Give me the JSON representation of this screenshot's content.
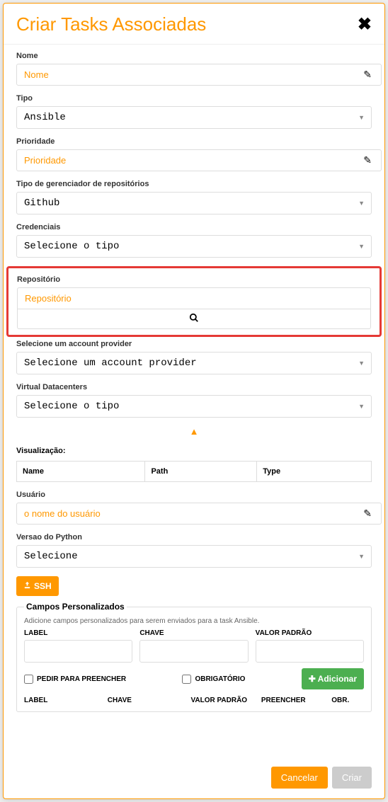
{
  "modal": {
    "title": "Criar Tasks Associadas"
  },
  "fields": {
    "name_label": "Nome",
    "name_placeholder": "Nome",
    "type_label": "Tipo",
    "type_value": "Ansible",
    "priority_label": "Prioridade",
    "priority_placeholder": "Prioridade",
    "repomgr_label": "Tipo de gerenciador de repositórios",
    "repomgr_value": "Github",
    "creds_label": "Credenciais",
    "creds_value": "Selecione o tipo",
    "repo_label": "Repositório",
    "repo_placeholder": "Repositório",
    "accprov_label": "Selecione um account provider",
    "accprov_value": "Selecione um account provider",
    "vdc_label": "Virtual Datacenters",
    "vdc_value": "Selecione o tipo",
    "vis_label": "Visualização:",
    "table": {
      "h1": "Name",
      "h2": "Path",
      "h3": "Type"
    },
    "user_label": "Usuário",
    "user_placeholder": "o nome do usuário",
    "pyver_label": "Versao do Python",
    "pyver_value": "Selecione",
    "ssh_label": "SSH"
  },
  "custom_fields": {
    "legend": "Campos Personalizados",
    "desc": "Adicione campos personalizados para serem enviados para a task Ansible.",
    "label": "LABEL",
    "key": "CHAVE",
    "default": "VALOR PADRÃO",
    "ask_fill": "PEDIR PARA PREENCHER",
    "mandatory": "OBRIGATÓRIO",
    "add": "Adicionar",
    "hdr_label": "LABEL",
    "hdr_key": "CHAVE",
    "hdr_default": "VALOR PADRÃO",
    "hdr_fill": "PREENCHER",
    "hdr_obr": "OBR."
  },
  "footer": {
    "cancel": "Cancelar",
    "create": "Criar"
  }
}
